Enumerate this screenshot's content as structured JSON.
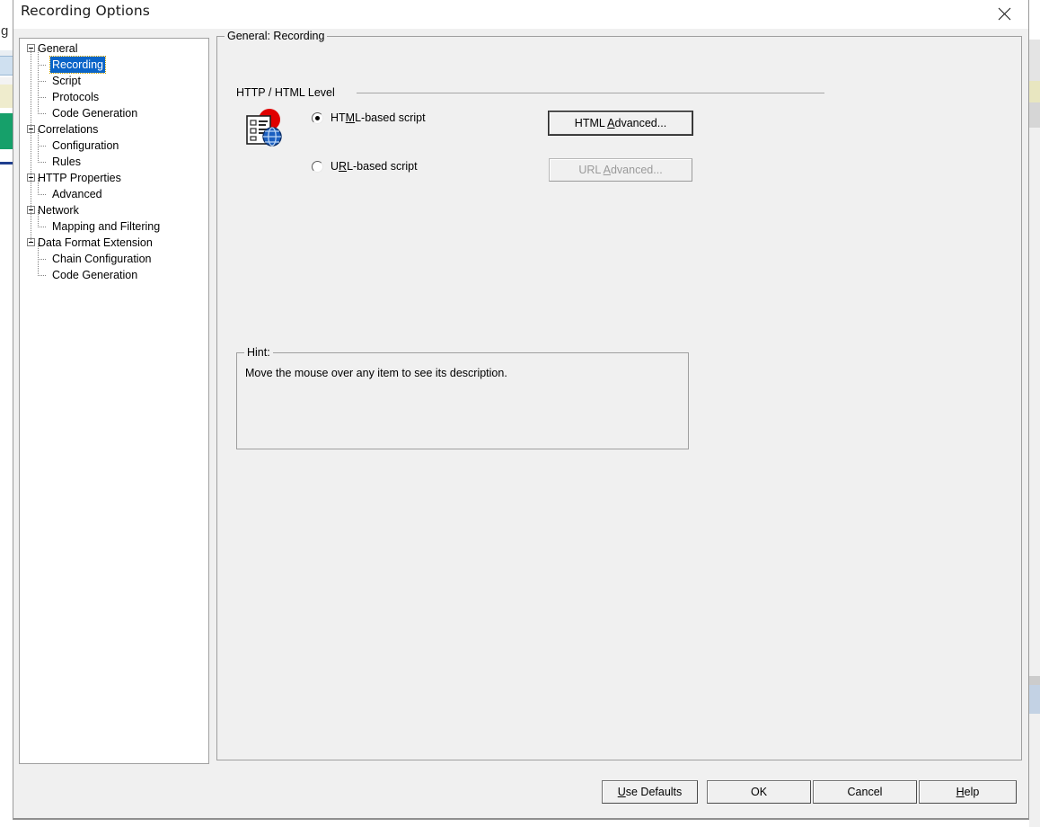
{
  "window": {
    "title": "Recording Options",
    "close_icon": "close-icon"
  },
  "tree": {
    "nodes": [
      {
        "label": "General",
        "level": 0,
        "expanded": true,
        "selected": false
      },
      {
        "label": "Recording",
        "level": 1,
        "expanded": false,
        "selected": true
      },
      {
        "label": "Script",
        "level": 1,
        "expanded": false,
        "selected": false
      },
      {
        "label": "Protocols",
        "level": 1,
        "expanded": false,
        "selected": false
      },
      {
        "label": "Code Generation",
        "level": 1,
        "expanded": false,
        "selected": false
      },
      {
        "label": "Correlations",
        "level": 0,
        "expanded": true,
        "selected": false
      },
      {
        "label": "Configuration",
        "level": 1,
        "expanded": false,
        "selected": false
      },
      {
        "label": "Rules",
        "level": 1,
        "expanded": false,
        "selected": false
      },
      {
        "label": "HTTP Properties",
        "level": 0,
        "expanded": true,
        "selected": false
      },
      {
        "label": "Advanced",
        "level": 1,
        "expanded": false,
        "selected": false
      },
      {
        "label": "Network",
        "level": 0,
        "expanded": true,
        "selected": false
      },
      {
        "label": "Mapping and Filtering",
        "level": 1,
        "expanded": false,
        "selected": false
      },
      {
        "label": "Data Format Extension",
        "level": 0,
        "expanded": true,
        "selected": false
      },
      {
        "label": "Chain Configuration",
        "level": 1,
        "expanded": false,
        "selected": false
      },
      {
        "label": "Code Generation",
        "level": 1,
        "expanded": false,
        "selected": false
      }
    ]
  },
  "main": {
    "group_title": "General: Recording",
    "section_label": "HTTP / HTML Level",
    "icon": "html-script-globe-icon",
    "options": [
      {
        "label_before": "HT",
        "label_accel": "M",
        "label_after": "L-based script",
        "selected": true,
        "enabled": true,
        "button": {
          "before": "HTML ",
          "accel": "A",
          "after": "dvanced...",
          "enabled": true,
          "is_default": true
        }
      },
      {
        "label_before": "U",
        "label_accel": "R",
        "label_after": "L-based script",
        "selected": false,
        "enabled": true,
        "button": {
          "before": "URL ",
          "accel": "A",
          "after": "dvanced...",
          "enabled": false,
          "is_default": false
        }
      }
    ],
    "hint": {
      "title": "Hint:",
      "text": "Move the mouse over any item to see its description."
    }
  },
  "footer": {
    "buttons": [
      {
        "before": "",
        "accel": "U",
        "after": "se Defaults"
      },
      {
        "before": "OK",
        "accel": "",
        "after": ""
      },
      {
        "before": "Cancel",
        "accel": "",
        "after": ""
      },
      {
        "before": "",
        "accel": "H",
        "after": "elp"
      }
    ]
  },
  "colors": {
    "dialog_face": "#f0f0f0",
    "selection_blue": "#0a64c8",
    "panel_white": "#ffffff",
    "icon_red": "#e00000",
    "icon_blue": "#1b5fc0"
  }
}
